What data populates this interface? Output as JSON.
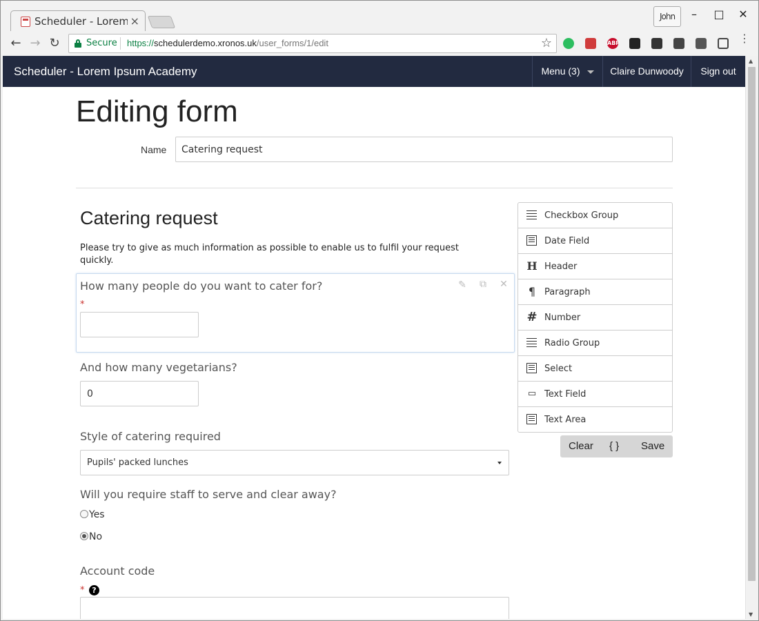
{
  "browser": {
    "tab_title": "Scheduler - Lorem Ipsum Academy",
    "tab_close": "×",
    "profile_name": "John",
    "window_controls": {
      "minimize": "–",
      "maximize": "□",
      "close": "✕"
    },
    "security_label": "Secure",
    "url_scheme": "https://",
    "url_host": "schedulerdemo.xronos.uk",
    "url_path": "/user_forms/1/edit",
    "nav": {
      "back": "←",
      "forward": "→",
      "reload": "↻"
    },
    "bookmark_icon": "☆",
    "menu_icon": "⋮",
    "extensions": [
      {
        "name": "evernote-icon",
        "color": "#2dbe60",
        "text": ""
      },
      {
        "name": "extension-red-icon",
        "color": "#d03c3c",
        "text": ""
      },
      {
        "name": "adblock-icon",
        "color": "#c70d2c",
        "text": "ABP"
      },
      {
        "name": "extension-home-icon",
        "color": "#222222",
        "text": ""
      },
      {
        "name": "extension-paw-icon",
        "color": "#333333",
        "text": ""
      },
      {
        "name": "lightbulb-icon",
        "color": "#444444",
        "text": ""
      },
      {
        "name": "mail-icon",
        "color": "#555555",
        "text": ""
      },
      {
        "name": "screenshot-icon",
        "color": "#444444",
        "text": ""
      }
    ]
  },
  "navbar": {
    "brand": "Scheduler - Lorem Ipsum Academy",
    "menu": "Menu (3)",
    "user": "Claire Dunwoody",
    "sign_out": "Sign out"
  },
  "page": {
    "title": "Editing form",
    "name_label": "Name",
    "name_value": "Catering request"
  },
  "form": {
    "heading": "Catering request",
    "paragraph": "Please try to give as much information as possible to enable us to fulfil your request quickly.",
    "q1_label": "How many people do you want to cater for?",
    "required_mark": "*",
    "q1_value": "",
    "q2_label": "And how many vegetarians?",
    "q2_value": "0",
    "q3_label": "Style of catering required",
    "q3_selected": "Pupils' packed lunches",
    "q4_label": "Will you require staff to serve and clear away?",
    "q4_options": [
      "Yes",
      "No"
    ],
    "q4_selected": "No",
    "q5_label": "Account code",
    "help_icon": "?"
  },
  "controls": [
    {
      "label": "Checkbox Group",
      "icon": "checkbox-group-icon"
    },
    {
      "label": "Date Field",
      "icon": "calendar-icon"
    },
    {
      "label": "Header",
      "icon": "header-icon"
    },
    {
      "label": "Paragraph",
      "icon": "paragraph-icon"
    },
    {
      "label": "Number",
      "icon": "hash-icon"
    },
    {
      "label": "Radio Group",
      "icon": "radio-group-icon"
    },
    {
      "label": "Select",
      "icon": "select-icon"
    },
    {
      "label": "Text Field",
      "icon": "text-field-icon"
    },
    {
      "label": "Text Area",
      "icon": "text-area-icon"
    }
  ],
  "actions": {
    "clear": "Clear",
    "json": "{ }",
    "save": "Save"
  }
}
